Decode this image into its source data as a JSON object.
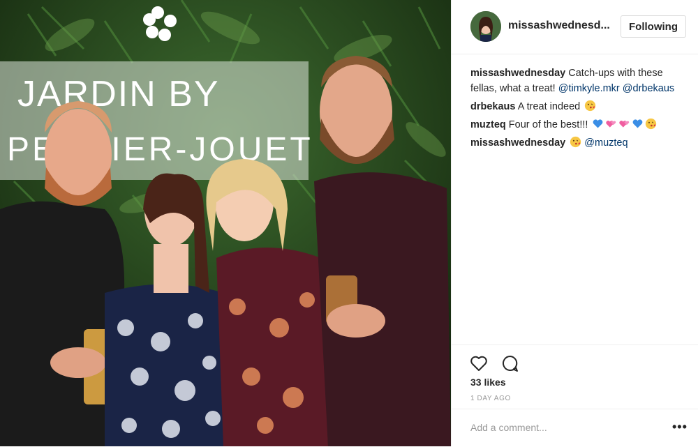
{
  "post": {
    "photo_sign_line1": "JARDIN BY",
    "photo_sign_line2": "PERRIER-JOUET",
    "author": "missashwednesd...",
    "follow_label": "Following",
    "comments": [
      {
        "user": "missashwednesday",
        "text": "Catch-ups with these fellas, what a treat!",
        "mentions": [
          "@timkyle.mkr",
          "@drbekaus"
        ]
      },
      {
        "user": "drbekaus",
        "text": "A treat indeed",
        "emoji": [
          "kiss-face"
        ]
      },
      {
        "user": "muzteq",
        "text": "Four of the best!!!",
        "emoji": [
          "blue-heart",
          "pink-hearts",
          "pink-hearts",
          "blue-heart",
          "kiss-face"
        ]
      },
      {
        "user": "missashwednesday",
        "text": "",
        "emoji": [
          "kiss-face"
        ],
        "mentions": [
          "@muzteq"
        ]
      }
    ],
    "likes": "33 likes",
    "time": "1 DAY AGO",
    "comment_placeholder": "Add a comment...",
    "more_label": "•••",
    "icons": {
      "like": "heart-icon",
      "comment": "comment-icon",
      "more": "more-options-icon"
    },
    "colors": {
      "mention": "#003569",
      "text": "#262626",
      "muted": "#999999",
      "border": "#efefef"
    }
  }
}
